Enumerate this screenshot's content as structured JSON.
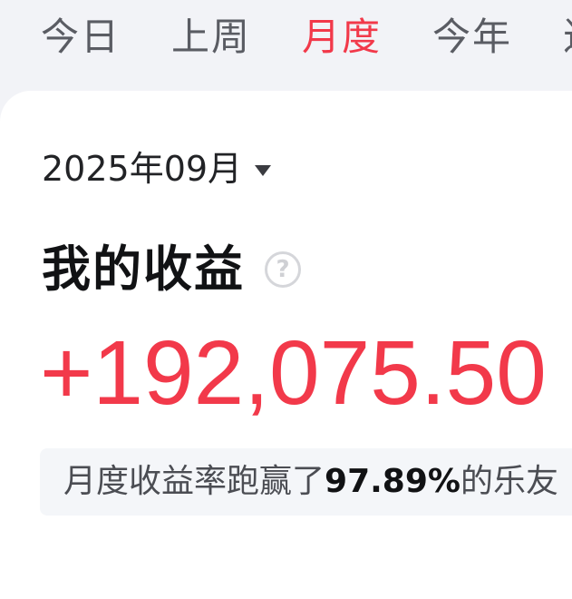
{
  "tabs": [
    {
      "label": "今日",
      "active": false
    },
    {
      "label": "上周",
      "active": false
    },
    {
      "label": "月度",
      "active": true
    },
    {
      "label": "今年",
      "active": false
    },
    {
      "label": "近",
      "active": false
    }
  ],
  "period": {
    "label": "2025年09月"
  },
  "earnings": {
    "title": "我的收益",
    "help_symbol": "?",
    "amount": "+192,075.50"
  },
  "beat": {
    "prefix": "月度收益率跑赢了",
    "percent": "97.89%",
    "suffix": "的乐友"
  },
  "colors": {
    "accent": "#f2394a",
    "background": "#f2f3f7",
    "card": "#ffffff"
  }
}
